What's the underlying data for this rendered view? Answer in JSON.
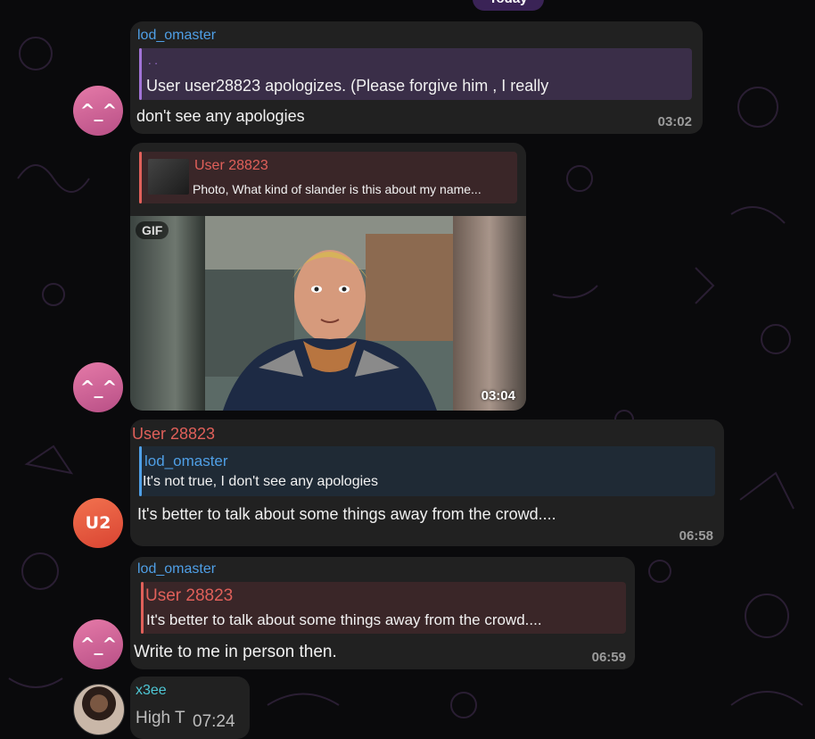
{
  "date_separator": "Today",
  "messages": [
    {
      "sender": "lod_omaster",
      "avatar_text": "^_^",
      "reply_preview": ". .",
      "reply_text": "User user28823 apologizes. (Please forgive him , I really",
      "text": "don't see any apologies",
      "time": "03:02"
    },
    {
      "reply_sender": "User 28823",
      "reply_text": "Photo, What kind of slander is this about my name...",
      "media_badge": "GIF",
      "avatar_text": "^_^",
      "time": "03:04"
    },
    {
      "sender": "User 28823",
      "avatar_text": "U2",
      "reply_sender": "lod_omaster",
      "reply_text": "It's not true, I don't see any apologies",
      "text": "It's better to talk about some things away from the crowd....",
      "time": "06:58"
    },
    {
      "sender": "lod_omaster",
      "avatar_text": "^_^",
      "reply_sender": "User 28823",
      "reply_text": "It's better to talk about some things away from the crowd....",
      "text": "Write to me in person then.",
      "time": "06:59"
    },
    {
      "sender": "x3ee",
      "text": "High T",
      "time": "07:24"
    }
  ],
  "colors": {
    "bubble": "#212121",
    "accent_blue": "#4f9fe6",
    "accent_red": "#e0605a",
    "accent_teal": "#4ec6d4",
    "avatar_pink": "#d4649a",
    "avatar_orange": "#e5553f"
  }
}
